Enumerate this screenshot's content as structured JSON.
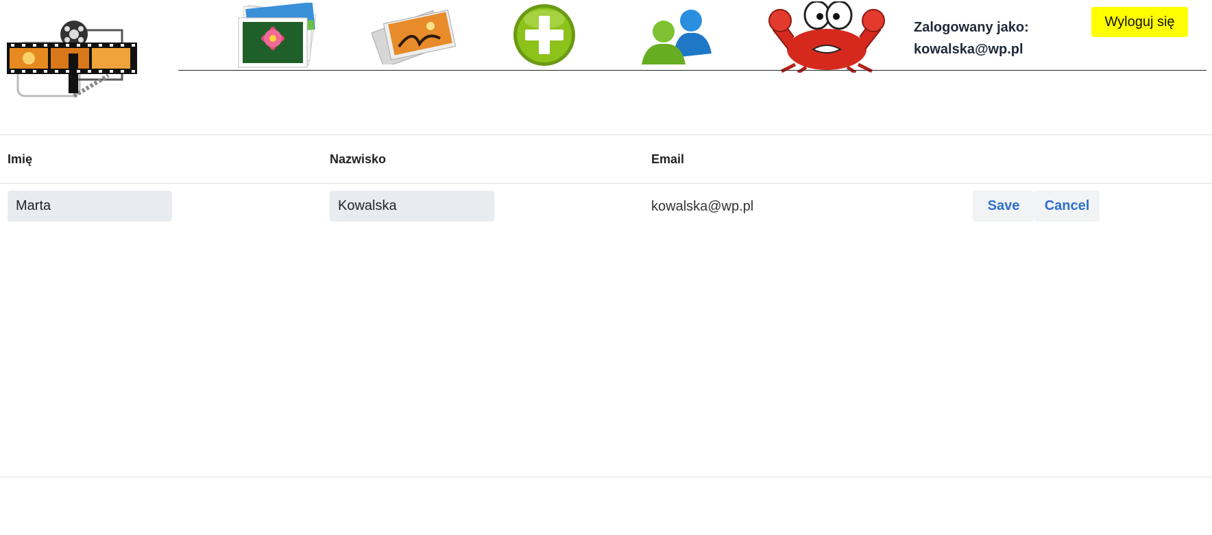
{
  "header": {
    "logo_icon": "film-camera-logo-icon",
    "nav_icons": [
      "photos-icon",
      "gallery-icon",
      "add-icon",
      "users-icon",
      "crab-icon"
    ],
    "user_label": "Zalogowany jako:",
    "user_email": "kowalska@wp.pl",
    "logout_label": "Wyloguj się",
    "logout_color": "#ffff00"
  },
  "table": {
    "columns": [
      "Imię",
      "Nazwisko",
      "Email"
    ],
    "row": {
      "first_name": "Marta",
      "last_name": "Kowalska",
      "email": "kowalska@wp.pl",
      "save_label": "Save",
      "cancel_label": "Cancel"
    }
  },
  "colors": {
    "action_text": "#2f6fce",
    "input_bg": "#e8ebef"
  }
}
